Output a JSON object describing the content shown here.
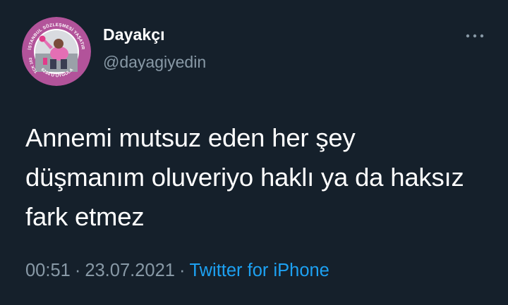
{
  "tweet": {
    "author": {
      "display_name": "Dayakçı",
      "handle": "@dayagiyedin",
      "avatar": {
        "top_text": "İSTANBUL SÖZLEŞMESİ YAŞATIR",
        "bottom_text": "6284'Ü UYGULA",
        "left_text": "TCK 103",
        "ring_color": "#b2539a"
      }
    },
    "more_icon": "more-horizontal-icon",
    "text": "Annemi mutsuz eden her şey\ndüşmanım oluveriyo haklı ya da haksız\nfark etmez",
    "time": "00:51",
    "date": "23.07.2021",
    "separator": "·",
    "source": "Twitter for iPhone"
  },
  "colors": {
    "background": "#15202b",
    "primary_text": "#ffffff",
    "secondary_text": "#8899a6",
    "accent": "#1da1f2"
  }
}
